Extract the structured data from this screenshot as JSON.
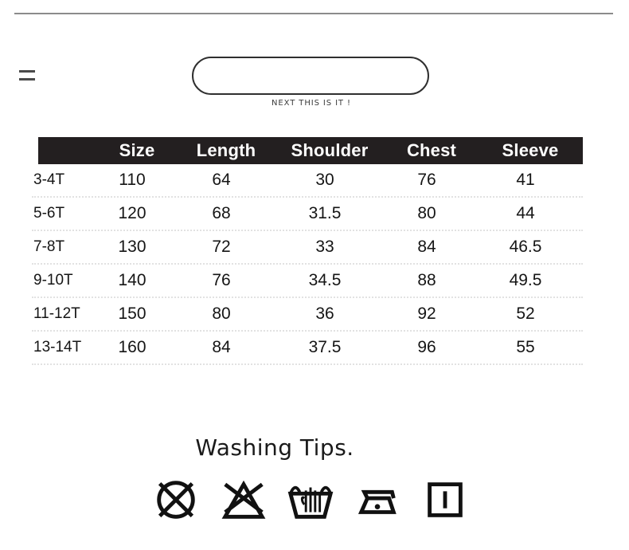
{
  "page": {
    "background": "#ffffff",
    "divider_color": "#8b8b8b"
  },
  "header": {
    "menu_icon": "equals-mark",
    "pill_box": {
      "value": "",
      "placeholder": ""
    },
    "pill_caption": "NEXT THIS IS IT !"
  },
  "size_table": {
    "header_bg": "#231f20",
    "header_text_color": "#ffffff",
    "columns": [
      "",
      "Size",
      "Length",
      "Shoulder",
      "Chest",
      "Sleeve"
    ],
    "rows": [
      {
        "age": "3-4T",
        "size": "110",
        "length": "64",
        "shoulder": "30",
        "chest": "76",
        "sleeve": "41"
      },
      {
        "age": "5-6T",
        "size": "120",
        "length": "68",
        "shoulder": "31.5",
        "chest": "80",
        "sleeve": "44"
      },
      {
        "age": "7-8T",
        "size": "130",
        "length": "72",
        "shoulder": "33",
        "chest": "84",
        "sleeve": "46.5"
      },
      {
        "age": "9-10T",
        "size": "140",
        "length": "76",
        "shoulder": "34.5",
        "chest": "88",
        "sleeve": "49.5"
      },
      {
        "age": "11-12T",
        "size": "150",
        "length": "80",
        "shoulder": "36",
        "chest": "92",
        "sleeve": "52"
      },
      {
        "age": "13-14T",
        "size": "160",
        "length": "84",
        "shoulder": "37.5",
        "chest": "96",
        "sleeve": "55"
      }
    ]
  },
  "washing": {
    "title": "Washing Tips.",
    "icons": [
      "do-not-dry-clean-icon",
      "do-not-bleach-icon",
      "hand-wash-icon",
      "iron-low-heat-icon",
      "drip-dry-icon"
    ]
  }
}
